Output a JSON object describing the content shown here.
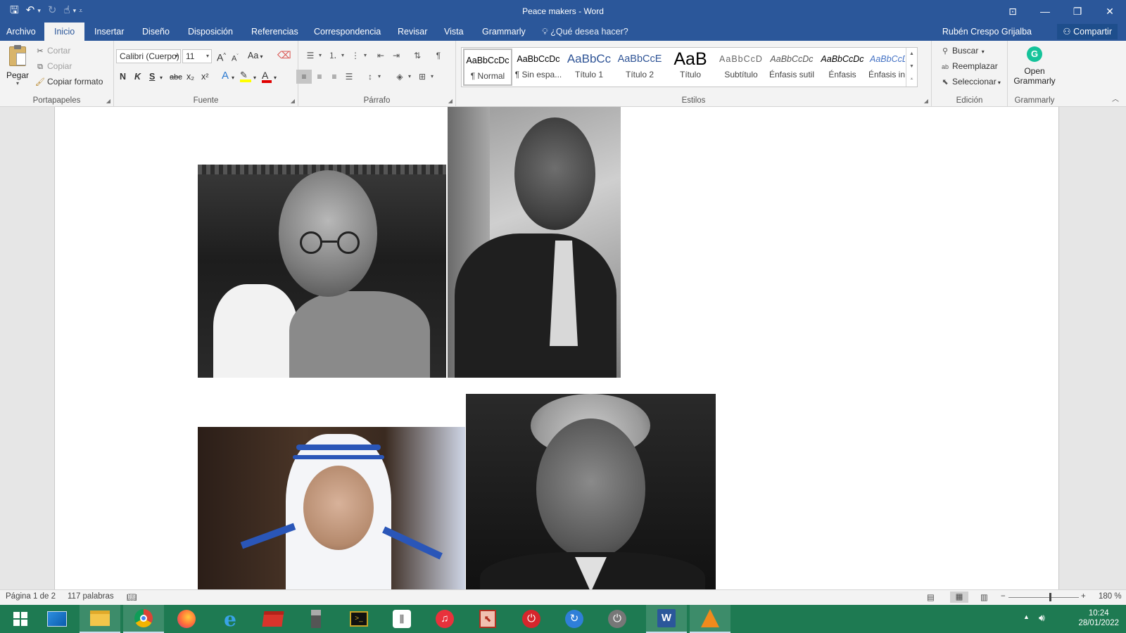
{
  "window": {
    "title": "Peace makers - Word"
  },
  "tabs": [
    {
      "label": "Archivo"
    },
    {
      "label": "Inicio"
    },
    {
      "label": "Insertar"
    },
    {
      "label": "Diseño"
    },
    {
      "label": "Disposición"
    },
    {
      "label": "Referencias"
    },
    {
      "label": "Correspondencia"
    },
    {
      "label": "Revisar"
    },
    {
      "label": "Vista"
    },
    {
      "label": "Grammarly"
    }
  ],
  "active_tab": "Inicio",
  "tell_me": "¿Qué desea hacer?",
  "user_name": "Rubén Crespo Grijalba",
  "share_label": "Compartir",
  "clipboard": {
    "paste": "Pegar",
    "cut": "Cortar",
    "copy": "Copiar",
    "format_painter": "Copiar formato",
    "label": "Portapapeles"
  },
  "font": {
    "name": "Calibri (Cuerpo)",
    "size": "11",
    "label": "Fuente",
    "bold": "N",
    "italic": "K",
    "underline": "S",
    "strike": "abc",
    "subscript": "x₂",
    "superscript": "x²",
    "grow": "A",
    "shrink": "A",
    "case": "Aa"
  },
  "paragraph": {
    "label": "Párrafo"
  },
  "styles": {
    "label": "Estilos",
    "items": [
      {
        "sample": "AaBbCcDc",
        "name": "¶ Normal"
      },
      {
        "sample": "AaBbCcDc",
        "name": "¶ Sin espa..."
      },
      {
        "sample": "AaBbCc",
        "name": "Título 1"
      },
      {
        "sample": "AaBbCcE",
        "name": "Título 2"
      },
      {
        "sample": "AaB",
        "name": "Título"
      },
      {
        "sample": "AaBbCcD",
        "name": "Subtítulo"
      },
      {
        "sample": "AaBbCcDc",
        "name": "Énfasis sutil"
      },
      {
        "sample": "AaBbCcDc",
        "name": "Énfasis"
      },
      {
        "sample": "AaBbCcDc",
        "name": "Énfasis int..."
      }
    ]
  },
  "editing": {
    "find": "Buscar",
    "replace": "Reemplazar",
    "select": "Seleccionar",
    "label": "Edición"
  },
  "grammarly_group": {
    "button_line1": "Open",
    "button_line2": "Grammarly",
    "label": "Grammarly"
  },
  "status": {
    "page": "Página 1 de 2",
    "words": "117 palabras",
    "zoom": "180 %"
  },
  "clock": {
    "time": "10:24",
    "date": "28/01/2022"
  },
  "colors": {
    "accent": "#2b579a",
    "ribbon_bg": "#f3f3f3",
    "taskbar": "#1e7a52",
    "highlight": "#ffff00",
    "font_color": "#e00000"
  }
}
